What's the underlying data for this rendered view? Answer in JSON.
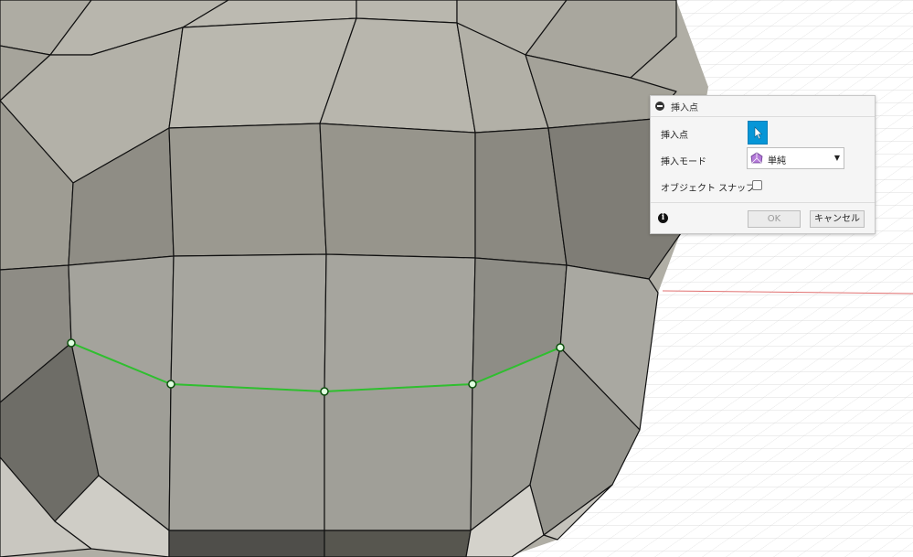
{
  "dialog": {
    "title": "挿入点",
    "rows": {
      "insert_point_label": "挿入点",
      "insert_mode_label": "挿入モード",
      "insert_mode_value": "単純",
      "object_snap_label": "オブジェクト スナップ",
      "object_snap_checked": false
    },
    "footer": {
      "ok_label": "OK",
      "cancel_label": "キャンセル"
    }
  },
  "viewport": {
    "mesh_color": "#8c8b82",
    "edge_color": "#111111",
    "selection_color": "#2fbf2f",
    "x_axis_color": "#e07070",
    "y_axis_color": "#7bd17b"
  },
  "icons": [
    "collapse-icon",
    "cursor-arrow-icon",
    "insert-mode-icon",
    "chevron-down-icon",
    "info-icon"
  ]
}
